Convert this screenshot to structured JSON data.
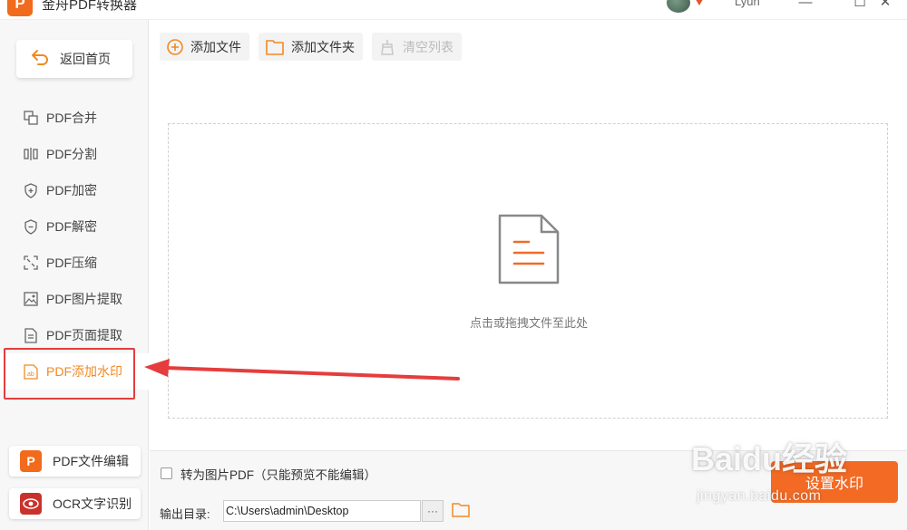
{
  "app": {
    "title": "金舟PDF转换器",
    "logo_letter": "P",
    "username": "Lyun"
  },
  "window": {
    "minimize": "—",
    "maximize": "☐",
    "close": "✕"
  },
  "sidebar": {
    "home_label": "返回首页",
    "items": [
      {
        "label": "PDF合并",
        "icon": "merge-icon"
      },
      {
        "label": "PDF分割",
        "icon": "split-icon"
      },
      {
        "label": "PDF加密",
        "icon": "shield-plus-icon"
      },
      {
        "label": "PDF解密",
        "icon": "shield-minus-icon"
      },
      {
        "label": "PDF压缩",
        "icon": "compress-icon"
      },
      {
        "label": "PDF图片提取",
        "icon": "image-icon"
      },
      {
        "label": "PDF页面提取",
        "icon": "page-icon"
      },
      {
        "label": "PDF添加水印",
        "icon": "watermark-icon",
        "active": true
      }
    ],
    "tools": [
      {
        "label": "PDF文件编辑",
        "icon": "pdf-editor-icon",
        "icon_text": "P",
        "color": "#f26a1b"
      },
      {
        "label": "OCR文字识别",
        "icon": "ocr-icon",
        "icon_text": "◉",
        "color": "#c9322c"
      }
    ]
  },
  "toolbar": {
    "add_file": "添加文件",
    "add_folder": "添加文件夹",
    "clear_list": "清空列表"
  },
  "dropzone": {
    "hint": "点击或拖拽文件至此处"
  },
  "bottom": {
    "convert_checkbox_label": "转为图片PDF（只能预览不能编辑）",
    "output_label": "输出目录:",
    "output_path": "C:\\Users\\admin\\Desktop",
    "browse_dots": "···",
    "start_button": "设置水印"
  },
  "watermark": {
    "main": "Baidu经验",
    "sub": "jingyan.baidu.com"
  },
  "colors": {
    "accent": "#f08a24",
    "primary_button": "#f26a24",
    "annotation": "#e53d3d"
  }
}
